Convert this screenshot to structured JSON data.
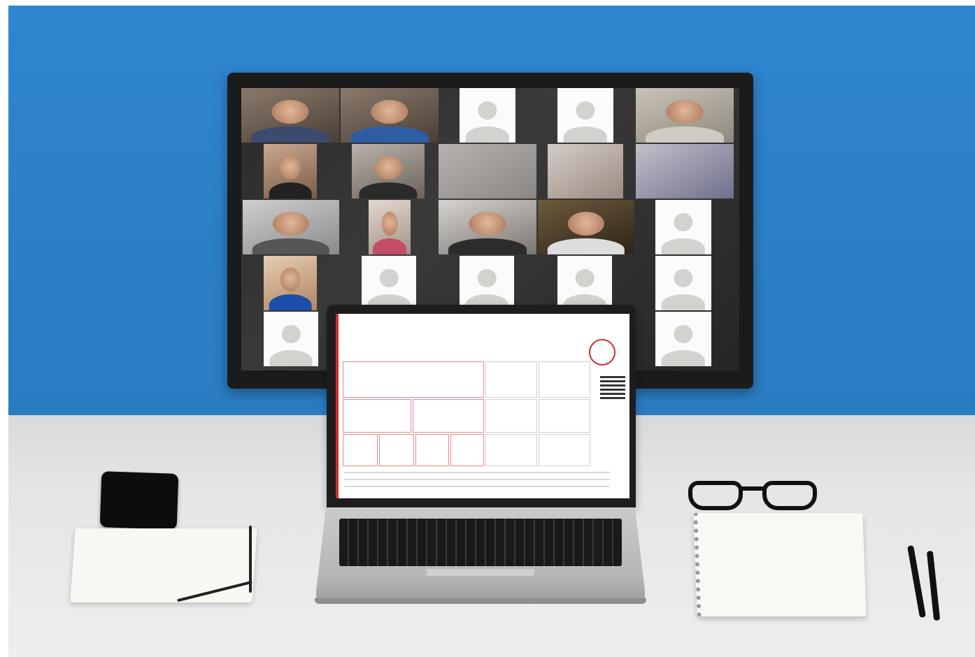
{
  "scene": {
    "monitor": {
      "tiles": [
        {
          "kind": "photo"
        },
        {
          "kind": "photo"
        },
        {
          "kind": "avatar"
        },
        {
          "kind": "avatar"
        },
        {
          "kind": "photo"
        },
        {
          "kind": "photo"
        },
        {
          "kind": "photo"
        },
        {
          "kind": "blur"
        },
        {
          "kind": "blur"
        },
        {
          "kind": "blur"
        },
        {
          "kind": "photo"
        },
        {
          "kind": "photo"
        },
        {
          "kind": "photo"
        },
        {
          "kind": "photo"
        },
        {
          "kind": "avatar"
        },
        {
          "kind": "photo"
        },
        {
          "kind": "avatar"
        },
        {
          "kind": "avatar"
        },
        {
          "kind": "avatar"
        },
        {
          "kind": "avatar"
        },
        {
          "kind": "avatar"
        },
        {
          "kind": "avatar"
        }
      ]
    },
    "laptop": {
      "document": {
        "line1": "",
        "line2": "",
        "line3": "",
        "link1": "",
        "link2": "",
        "header_cell": ""
      }
    },
    "colors": {
      "wall": "#2f86cf",
      "desk": "#e4e5e6",
      "accent": "#d12c2c"
    }
  }
}
